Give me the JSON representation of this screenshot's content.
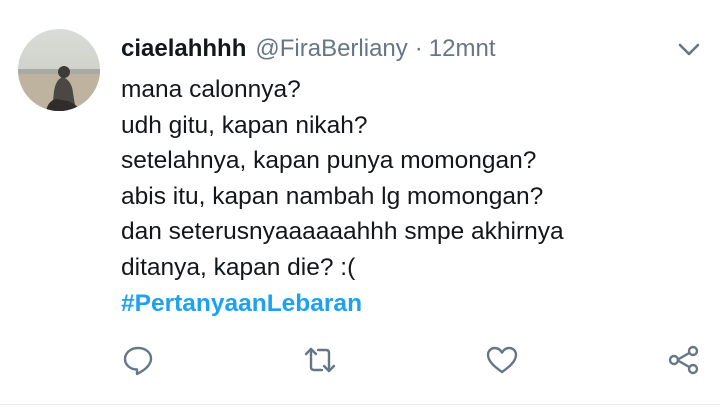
{
  "tweet": {
    "display_name": "ciaelahhhh",
    "handle": "@FiraBerliany",
    "separator": "·",
    "time": "12mnt",
    "lines": [
      "mana calonnya?",
      "udh gitu, kapan nikah?",
      "setelahnya, kapan punya momongan?",
      "abis itu, kapan nambah lg momongan?",
      "dan seterusnyaaaaaahhh smpe akhirnya",
      "ditanya, kapan die? :("
    ],
    "hashtag": "#PertanyaanLebaran"
  },
  "icons": {
    "menu": "chevron-down-icon",
    "reply": "reply-icon",
    "retweet": "retweet-icon",
    "like": "heart-icon",
    "share": "share-icon"
  },
  "colors": {
    "text": "#14171a",
    "secondary": "#657786",
    "link": "#1da1f2",
    "divider": "#e6ecf0"
  }
}
